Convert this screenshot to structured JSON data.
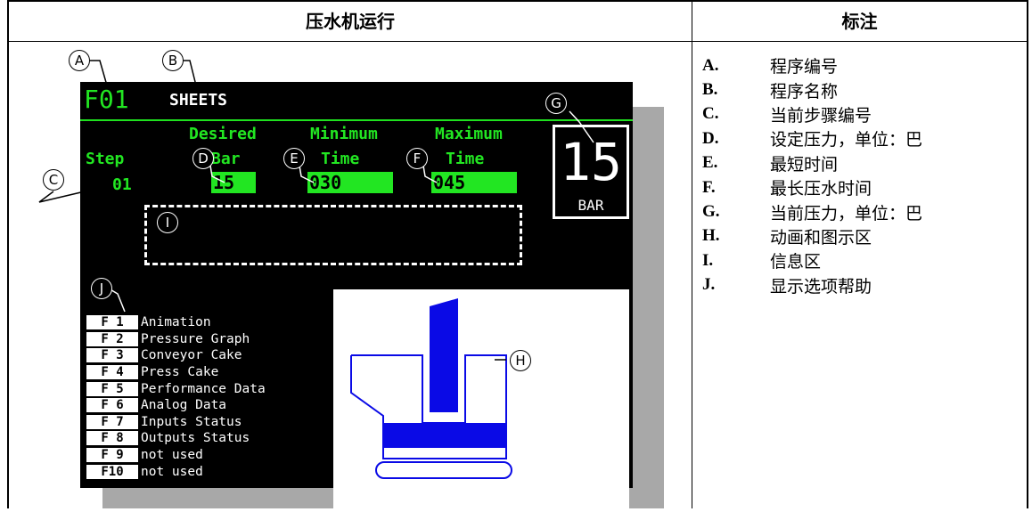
{
  "header": {
    "left_title": "压水机运行",
    "right_title": "标注"
  },
  "screen": {
    "program_number": "F01",
    "program_name": "SHEETS",
    "step_label": "Step",
    "step_value": "01",
    "col_desired": "Desired",
    "col_desired_unit": "Bar",
    "col_minimum": "Minimum",
    "col_minimum_unit": "Time",
    "col_maximum": "Maximum",
    "col_maximum_unit": "Time",
    "desired_value": "15",
    "minimum_value": "030",
    "maximum_value": "045",
    "current_pressure": "15",
    "pressure_unit": "BAR",
    "function_keys": [
      {
        "key": "F 1",
        "label": "Animation"
      },
      {
        "key": "F 2",
        "label": "Pressure Graph"
      },
      {
        "key": "F 3",
        "label": "Conveyor Cake"
      },
      {
        "key": "F 4",
        "label": "Press Cake"
      },
      {
        "key": "F 5",
        "label": "Performance Data"
      },
      {
        "key": "F 6",
        "label": "Analog Data"
      },
      {
        "key": "F 7",
        "label": "Inputs Status"
      },
      {
        "key": "F 8",
        "label": "Outputs Status"
      },
      {
        "key": "F 9",
        "label": "not used"
      },
      {
        "key": "F10",
        "label": "not used"
      }
    ],
    "colors": {
      "screen_bg": "#000000",
      "accent_green": "#22e622",
      "animation_blue": "#0a0ae6"
    }
  },
  "callouts": [
    "A",
    "B",
    "C",
    "D",
    "E",
    "F",
    "G",
    "H",
    "I",
    "J"
  ],
  "legend": [
    {
      "letter": "A.",
      "text": "程序编号"
    },
    {
      "letter": "B.",
      "text": "程序名称"
    },
    {
      "letter": "C.",
      "text": "当前步骤编号"
    },
    {
      "letter": "D.",
      "text": "设定压力，单位：巴"
    },
    {
      "letter": "E.",
      "text": "最短时间"
    },
    {
      "letter": "F.",
      "text": "最长压水时间"
    },
    {
      "letter": "G.",
      "text": "当前压力，单位：巴"
    },
    {
      "letter": "H.",
      "text": "动画和图示区"
    },
    {
      "letter": "I.",
      "text": "信息区"
    },
    {
      "letter": "J.",
      "text": "显示选项帮助"
    }
  ]
}
